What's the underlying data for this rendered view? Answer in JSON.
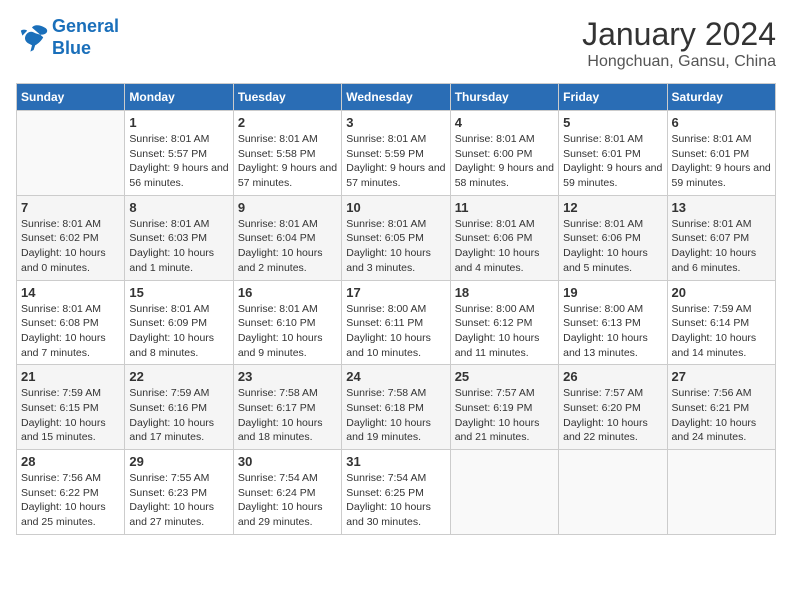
{
  "logo": {
    "line1": "General",
    "line2": "Blue"
  },
  "title": "January 2024",
  "location": "Hongchuan, Gansu, China",
  "days_of_week": [
    "Sunday",
    "Monday",
    "Tuesday",
    "Wednesday",
    "Thursday",
    "Friday",
    "Saturday"
  ],
  "weeks": [
    [
      {
        "day": "",
        "sunrise": "",
        "sunset": "",
        "daylight": ""
      },
      {
        "day": "1",
        "sunrise": "Sunrise: 8:01 AM",
        "sunset": "Sunset: 5:57 PM",
        "daylight": "Daylight: 9 hours and 56 minutes."
      },
      {
        "day": "2",
        "sunrise": "Sunrise: 8:01 AM",
        "sunset": "Sunset: 5:58 PM",
        "daylight": "Daylight: 9 hours and 57 minutes."
      },
      {
        "day": "3",
        "sunrise": "Sunrise: 8:01 AM",
        "sunset": "Sunset: 5:59 PM",
        "daylight": "Daylight: 9 hours and 57 minutes."
      },
      {
        "day": "4",
        "sunrise": "Sunrise: 8:01 AM",
        "sunset": "Sunset: 6:00 PM",
        "daylight": "Daylight: 9 hours and 58 minutes."
      },
      {
        "day": "5",
        "sunrise": "Sunrise: 8:01 AM",
        "sunset": "Sunset: 6:01 PM",
        "daylight": "Daylight: 9 hours and 59 minutes."
      },
      {
        "day": "6",
        "sunrise": "Sunrise: 8:01 AM",
        "sunset": "Sunset: 6:01 PM",
        "daylight": "Daylight: 9 hours and 59 minutes."
      }
    ],
    [
      {
        "day": "7",
        "sunrise": "Sunrise: 8:01 AM",
        "sunset": "Sunset: 6:02 PM",
        "daylight": "Daylight: 10 hours and 0 minutes."
      },
      {
        "day": "8",
        "sunrise": "Sunrise: 8:01 AM",
        "sunset": "Sunset: 6:03 PM",
        "daylight": "Daylight: 10 hours and 1 minute."
      },
      {
        "day": "9",
        "sunrise": "Sunrise: 8:01 AM",
        "sunset": "Sunset: 6:04 PM",
        "daylight": "Daylight: 10 hours and 2 minutes."
      },
      {
        "day": "10",
        "sunrise": "Sunrise: 8:01 AM",
        "sunset": "Sunset: 6:05 PM",
        "daylight": "Daylight: 10 hours and 3 minutes."
      },
      {
        "day": "11",
        "sunrise": "Sunrise: 8:01 AM",
        "sunset": "Sunset: 6:06 PM",
        "daylight": "Daylight: 10 hours and 4 minutes."
      },
      {
        "day": "12",
        "sunrise": "Sunrise: 8:01 AM",
        "sunset": "Sunset: 6:06 PM",
        "daylight": "Daylight: 10 hours and 5 minutes."
      },
      {
        "day": "13",
        "sunrise": "Sunrise: 8:01 AM",
        "sunset": "Sunset: 6:07 PM",
        "daylight": "Daylight: 10 hours and 6 minutes."
      }
    ],
    [
      {
        "day": "14",
        "sunrise": "Sunrise: 8:01 AM",
        "sunset": "Sunset: 6:08 PM",
        "daylight": "Daylight: 10 hours and 7 minutes."
      },
      {
        "day": "15",
        "sunrise": "Sunrise: 8:01 AM",
        "sunset": "Sunset: 6:09 PM",
        "daylight": "Daylight: 10 hours and 8 minutes."
      },
      {
        "day": "16",
        "sunrise": "Sunrise: 8:01 AM",
        "sunset": "Sunset: 6:10 PM",
        "daylight": "Daylight: 10 hours and 9 minutes."
      },
      {
        "day": "17",
        "sunrise": "Sunrise: 8:00 AM",
        "sunset": "Sunset: 6:11 PM",
        "daylight": "Daylight: 10 hours and 10 minutes."
      },
      {
        "day": "18",
        "sunrise": "Sunrise: 8:00 AM",
        "sunset": "Sunset: 6:12 PM",
        "daylight": "Daylight: 10 hours and 11 minutes."
      },
      {
        "day": "19",
        "sunrise": "Sunrise: 8:00 AM",
        "sunset": "Sunset: 6:13 PM",
        "daylight": "Daylight: 10 hours and 13 minutes."
      },
      {
        "day": "20",
        "sunrise": "Sunrise: 7:59 AM",
        "sunset": "Sunset: 6:14 PM",
        "daylight": "Daylight: 10 hours and 14 minutes."
      }
    ],
    [
      {
        "day": "21",
        "sunrise": "Sunrise: 7:59 AM",
        "sunset": "Sunset: 6:15 PM",
        "daylight": "Daylight: 10 hours and 15 minutes."
      },
      {
        "day": "22",
        "sunrise": "Sunrise: 7:59 AM",
        "sunset": "Sunset: 6:16 PM",
        "daylight": "Daylight: 10 hours and 17 minutes."
      },
      {
        "day": "23",
        "sunrise": "Sunrise: 7:58 AM",
        "sunset": "Sunset: 6:17 PM",
        "daylight": "Daylight: 10 hours and 18 minutes."
      },
      {
        "day": "24",
        "sunrise": "Sunrise: 7:58 AM",
        "sunset": "Sunset: 6:18 PM",
        "daylight": "Daylight: 10 hours and 19 minutes."
      },
      {
        "day": "25",
        "sunrise": "Sunrise: 7:57 AM",
        "sunset": "Sunset: 6:19 PM",
        "daylight": "Daylight: 10 hours and 21 minutes."
      },
      {
        "day": "26",
        "sunrise": "Sunrise: 7:57 AM",
        "sunset": "Sunset: 6:20 PM",
        "daylight": "Daylight: 10 hours and 22 minutes."
      },
      {
        "day": "27",
        "sunrise": "Sunrise: 7:56 AM",
        "sunset": "Sunset: 6:21 PM",
        "daylight": "Daylight: 10 hours and 24 minutes."
      }
    ],
    [
      {
        "day": "28",
        "sunrise": "Sunrise: 7:56 AM",
        "sunset": "Sunset: 6:22 PM",
        "daylight": "Daylight: 10 hours and 25 minutes."
      },
      {
        "day": "29",
        "sunrise": "Sunrise: 7:55 AM",
        "sunset": "Sunset: 6:23 PM",
        "daylight": "Daylight: 10 hours and 27 minutes."
      },
      {
        "day": "30",
        "sunrise": "Sunrise: 7:54 AM",
        "sunset": "Sunset: 6:24 PM",
        "daylight": "Daylight: 10 hours and 29 minutes."
      },
      {
        "day": "31",
        "sunrise": "Sunrise: 7:54 AM",
        "sunset": "Sunset: 6:25 PM",
        "daylight": "Daylight: 10 hours and 30 minutes."
      },
      {
        "day": "",
        "sunrise": "",
        "sunset": "",
        "daylight": ""
      },
      {
        "day": "",
        "sunrise": "",
        "sunset": "",
        "daylight": ""
      },
      {
        "day": "",
        "sunrise": "",
        "sunset": "",
        "daylight": ""
      }
    ]
  ]
}
